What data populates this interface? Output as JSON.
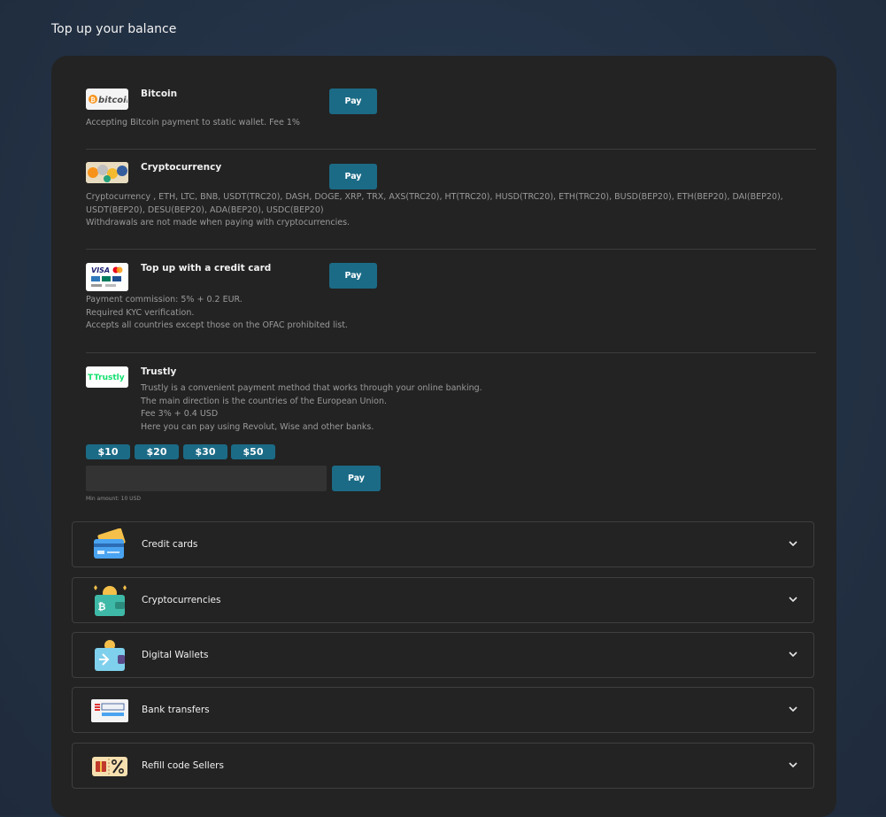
{
  "page": {
    "title": "Top up your balance"
  },
  "methods": [
    {
      "name": "Bitcoin",
      "logo_text": "bitcoin",
      "icon": "bitcoin-logo",
      "pay_label": "Pay",
      "description": "Accepting Bitcoin payment to static wallet. Fee 1%"
    },
    {
      "name": "Cryptocurrency",
      "icon": "crypto-coins-logo",
      "pay_label": "Pay",
      "description": "Cryptocurrency , ETH, LTC, BNB, USDT(TRC20), DASH, DOGE, XRP, TRX, AXS(TRC20), HT(TRC20), HUSD(TRC20), ETH(TRC20), BUSD(BEP20), ETH(BEP20), DAI(BEP20),\nUSDT(BEP20), DESU(BEP20), ADA(BEP20), USDC(BEP20)\nWithdrawals are not made when paying with cryptocurrencies."
    },
    {
      "name": "Top up with a credit card",
      "icon": "visa-mastercard-logo",
      "logo_text": "VISA",
      "pay_label": "Pay",
      "description": "Payment commission: 5% + 0.2 EUR.\nRequired KYC verification.\nAccepts all countries except those on the OFAC prohibited list."
    },
    {
      "name": "Trustly",
      "icon": "trustly-logo",
      "logo_text": "Trustly",
      "description": "Trustly is a convenient payment method that works through your online banking.\nThe main direction is the countries of the European Union.\nFee 3% + 0.4 USD\nHere you can pay using Revolut, Wise and other banks.",
      "amounts": [
        "$10",
        "$20",
        "$30",
        "$50"
      ],
      "amount_value": "",
      "pay_label": "Pay",
      "hint": "Min amount: 10 USD"
    }
  ],
  "accordions": [
    {
      "label": "Credit cards",
      "icon": "credit-cards-icon"
    },
    {
      "label": "Cryptocurrencies",
      "icon": "crypto-wallet-icon"
    },
    {
      "label": "Digital Wallets",
      "icon": "digital-wallet-icon"
    },
    {
      "label": "Bank transfers",
      "icon": "bank-transfer-icon"
    },
    {
      "label": "Refill code Sellers",
      "icon": "coupon-icon"
    }
  ],
  "colors": {
    "accent": "#1b6b86",
    "panel": "#232323",
    "background": "#243347"
  }
}
